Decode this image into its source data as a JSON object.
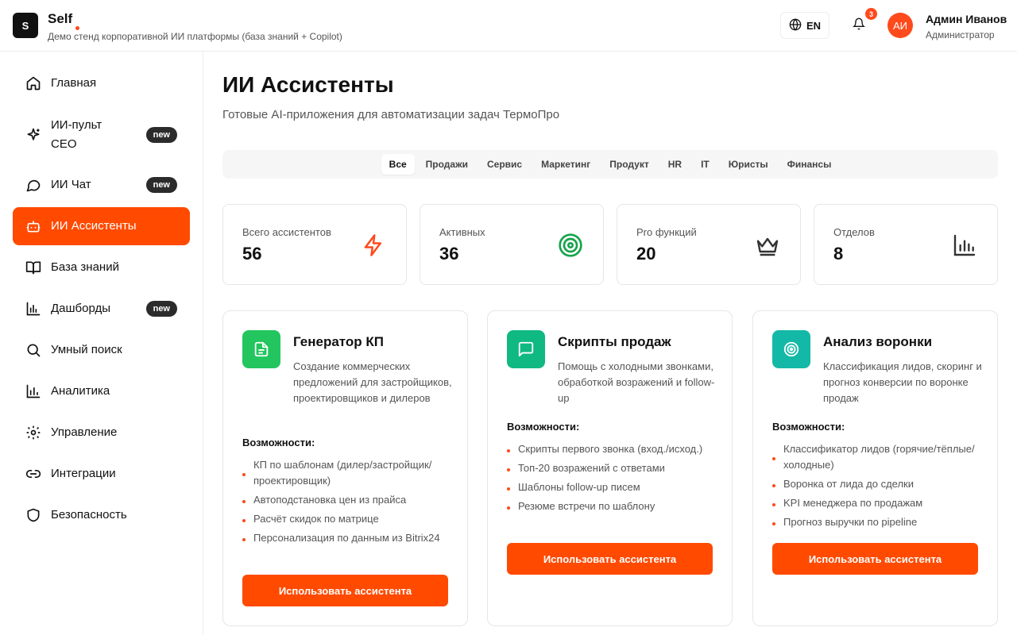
{
  "header": {
    "logo_letter": "S",
    "app_title": "Self",
    "app_subtitle": "Демо стенд корпоративной ИИ платформы (база знаний + Copilot)",
    "lang": "EN",
    "notifications_count": "3",
    "avatar_initials": "АИ",
    "user_name": "Админ Иванов",
    "user_role": "Администратор",
    "accent_color": "#ff4a1c"
  },
  "sidebar": {
    "items": [
      {
        "label": "Главная",
        "icon": "home-icon"
      },
      {
        "label": "ИИ-пульт CEO",
        "icon": "sparkles-icon",
        "badge": "new"
      },
      {
        "label": "ИИ Чат",
        "icon": "chat-bubble-icon",
        "badge": "new"
      },
      {
        "label": "ИИ Ассистенты",
        "icon": "bot-icon",
        "active": true
      },
      {
        "label": "База знаний",
        "icon": "book-icon"
      },
      {
        "label": "Дашборды",
        "icon": "bar-chart-icon",
        "badge": "new"
      },
      {
        "label": "Умный поиск",
        "icon": "search-icon"
      },
      {
        "label": "Аналитика",
        "icon": "analytics-icon"
      },
      {
        "label": "Управление",
        "icon": "gear-icon"
      },
      {
        "label": "Интеграции",
        "icon": "link-icon"
      },
      {
        "label": "Безопасность",
        "icon": "shield-icon"
      }
    ]
  },
  "main": {
    "title": "ИИ Ассистенты",
    "subtitle": "Готовые AI-приложения для автоматизации задач ТермоПро",
    "filters": [
      "Все",
      "Продажи",
      "Сервис",
      "Маркетинг",
      "Продукт",
      "HR",
      "IT",
      "Юристы",
      "Финансы"
    ],
    "active_filter": "Все",
    "stats": [
      {
        "label": "Всего ассистентов",
        "value": "56",
        "icon": "lightning-icon",
        "color": "#ff4a1c"
      },
      {
        "label": "Активных",
        "value": "36",
        "icon": "target-icon",
        "color": "#16a34a"
      },
      {
        "label": "Pro функций",
        "value": "20",
        "icon": "crown-icon",
        "color": "#333333"
      },
      {
        "label": "Отделов",
        "value": "8",
        "icon": "bar-chart-icon",
        "color": "#333333"
      }
    ],
    "features_heading": "Возможности:",
    "use_button_label": "Использовать ассистента",
    "assistants": [
      {
        "title": "Генератор КП",
        "description": "Создание коммерческих предложений для застройщиков, проектировщиков и дилеров",
        "icon": "document-icon",
        "icon_color": "#22c55e",
        "features": [
          "КП по шаблонам (дилер/застройщик/проектировщик)",
          "Автоподстановка цен из прайса",
          "Расчёт скидок по матрице",
          "Персонализация по данным из Bitrix24"
        ]
      },
      {
        "title": "Скрипты продаж",
        "description": "Помощь с холодными звонками, обработкой возражений и follow-up",
        "icon": "message-square-icon",
        "icon_color": "#10b981",
        "features": [
          "Скрипты первого звонка (вход./исход.)",
          "Топ-20 возражений с ответами",
          "Шаблоны follow-up писем",
          "Резюме встречи по шаблону"
        ]
      },
      {
        "title": "Анализ воронки",
        "description": "Классификация лидов, скоринг и прогноз конверсии по воронке продаж",
        "icon": "target-icon",
        "icon_color": "#14b8a6",
        "features": [
          "Классификатор лидов (горячие/тёплые/холодные)",
          "Воронка от лида до сделки",
          "KPI менеджера по продажам",
          "Прогноз выручки по pipeline"
        ]
      }
    ]
  }
}
